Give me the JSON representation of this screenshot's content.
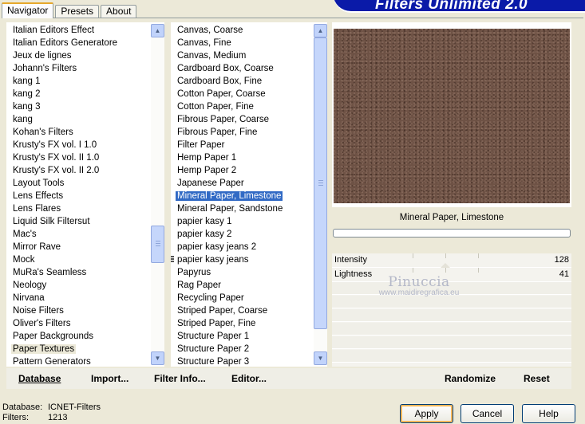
{
  "tabs": [
    {
      "label": "Navigator",
      "active": true
    },
    {
      "label": "Presets",
      "active": false
    },
    {
      "label": "About",
      "active": false
    }
  ],
  "banner": {
    "title": "Filters Unlimited 2.0",
    "color": "#0a1aa8"
  },
  "categories": [
    "Italian Editors Effect",
    "Italian Editors Generatore",
    "Jeux de lignes",
    "Johann's Filters",
    "kang 1",
    "kang 2",
    "kang 3",
    "kang",
    "Kohan's Filters",
    "Krusty's FX vol. I 1.0",
    "Krusty's FX vol. II 1.0",
    "Krusty's FX vol. II 2.0",
    "Layout Tools",
    "Lens Effects",
    "Lens Flares",
    "Liquid Silk Filtersut",
    "Mac's",
    "Mirror Rave",
    "Mock",
    "MuRa's Seamless",
    "Neology",
    "Nirvana",
    "Noise Filters",
    "Oliver's Filters",
    "Paper Backgrounds",
    "Paper Textures",
    "Pattern Generators"
  ],
  "selected_category": "Paper Textures",
  "filters": [
    "Canvas, Coarse",
    "Canvas, Fine",
    "Canvas, Medium",
    "Cardboard Box, Coarse",
    "Cardboard Box, Fine",
    "Cotton Paper, Coarse",
    "Cotton Paper, Fine",
    "Fibrous Paper, Coarse",
    "Fibrous Paper, Fine",
    "Filter Paper",
    "Hemp Paper 1",
    "Hemp Paper 2",
    "Japanese Paper",
    "Mineral Paper, Limestone",
    "Mineral Paper, Sandstone",
    "papier kasy 1",
    "papier kasy 2",
    "papier kasy jeans 2",
    "papier kasy jeans",
    "Papyrus",
    "Rag Paper",
    "Recycling Paper",
    "Striped Paper, Coarse",
    "Striped Paper, Fine",
    "Structure Paper 1",
    "Structure Paper 2",
    "Structure Paper 3"
  ],
  "selected_filter": "Mineral Paper, Limestone",
  "scroll": {
    "categories_position": 0.68,
    "categories_visible": 0.12,
    "filters_position": 0.0,
    "filters_visible": 0.93
  },
  "preview": {
    "filter_name": "Mineral Paper, Limestone",
    "texture_color": "#6e5245"
  },
  "params": [
    {
      "name": "Intensity",
      "value": "128",
      "fraction": 0.5
    },
    {
      "name": "Lightness",
      "value": "41",
      "fraction": 0.16
    }
  ],
  "watermark": {
    "name": "Pinuccia",
    "url": "www.maidiregrafica.eu"
  },
  "commands": {
    "database": "Database",
    "import": "Import...",
    "filter_info": "Filter Info...",
    "editor": "Editor...",
    "randomize": "Randomize",
    "reset": "Reset"
  },
  "footer": {
    "database_label": "Database:",
    "database_value": "ICNET-Filters",
    "filters_label": "Filters:",
    "filters_value": "1213"
  },
  "buttons": {
    "apply": "Apply",
    "cancel": "Cancel",
    "help": "Help"
  },
  "colors": {
    "selection": "#316ac5",
    "accent_tab": "#e6a82c",
    "background": "#ece9d8"
  }
}
